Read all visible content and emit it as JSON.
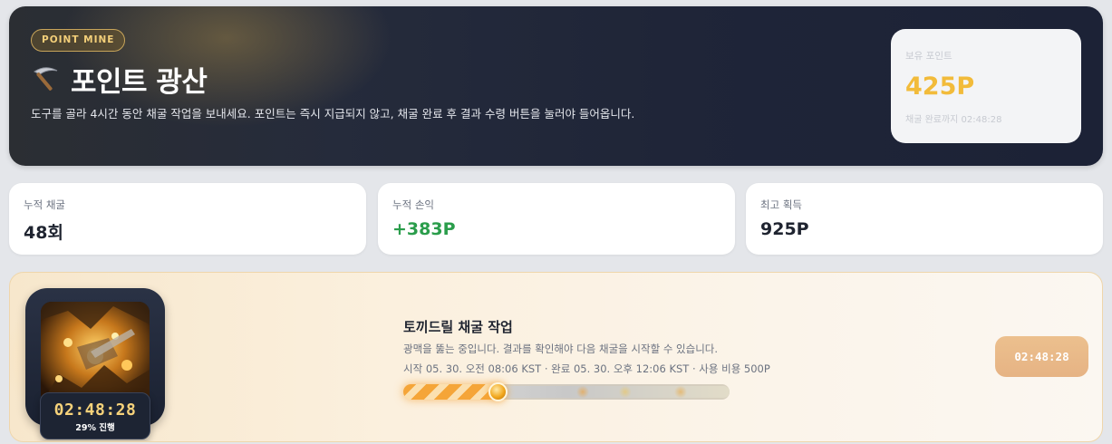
{
  "hero": {
    "badge": "POINT MINE",
    "title": "포인트 광산",
    "title_icon": "pickaxe-icon",
    "description": "도구를 골라 4시간 동안 채굴 작업을 보내세요. 포인트는 즉시 지급되지 않고, 채굴 완료 후 결과 수령 버튼을 눌러야 들어옵니다."
  },
  "balance": {
    "label": "보유 포인트",
    "value": "425P",
    "sub": "채굴 완료까지 02:48:28",
    "accent": "#f2bb3a"
  },
  "stats": [
    {
      "label": "누적 채굴",
      "value": "48회"
    },
    {
      "label": "누적 손익",
      "value": "+383P",
      "color": "#2a9d4b"
    },
    {
      "label": "최고 획득",
      "value": "925P"
    }
  ],
  "job": {
    "title": "토끼드릴 채굴 작업",
    "description": "광맥을 뚫는 중입니다. 결과를 확인해야 다음 채굴을 시작할 수 있습니다.",
    "meta": "시작 05. 30. 오전 08:06 KST · 완료 05. 30. 오후 12:06 KST · 사용 비용 500P",
    "timer": "02:48:28",
    "progress_text": "29% 진행",
    "progress_fraction": 0.29,
    "timer_button": "02:48:28",
    "tool_image": "gold-mine-drill-image"
  }
}
